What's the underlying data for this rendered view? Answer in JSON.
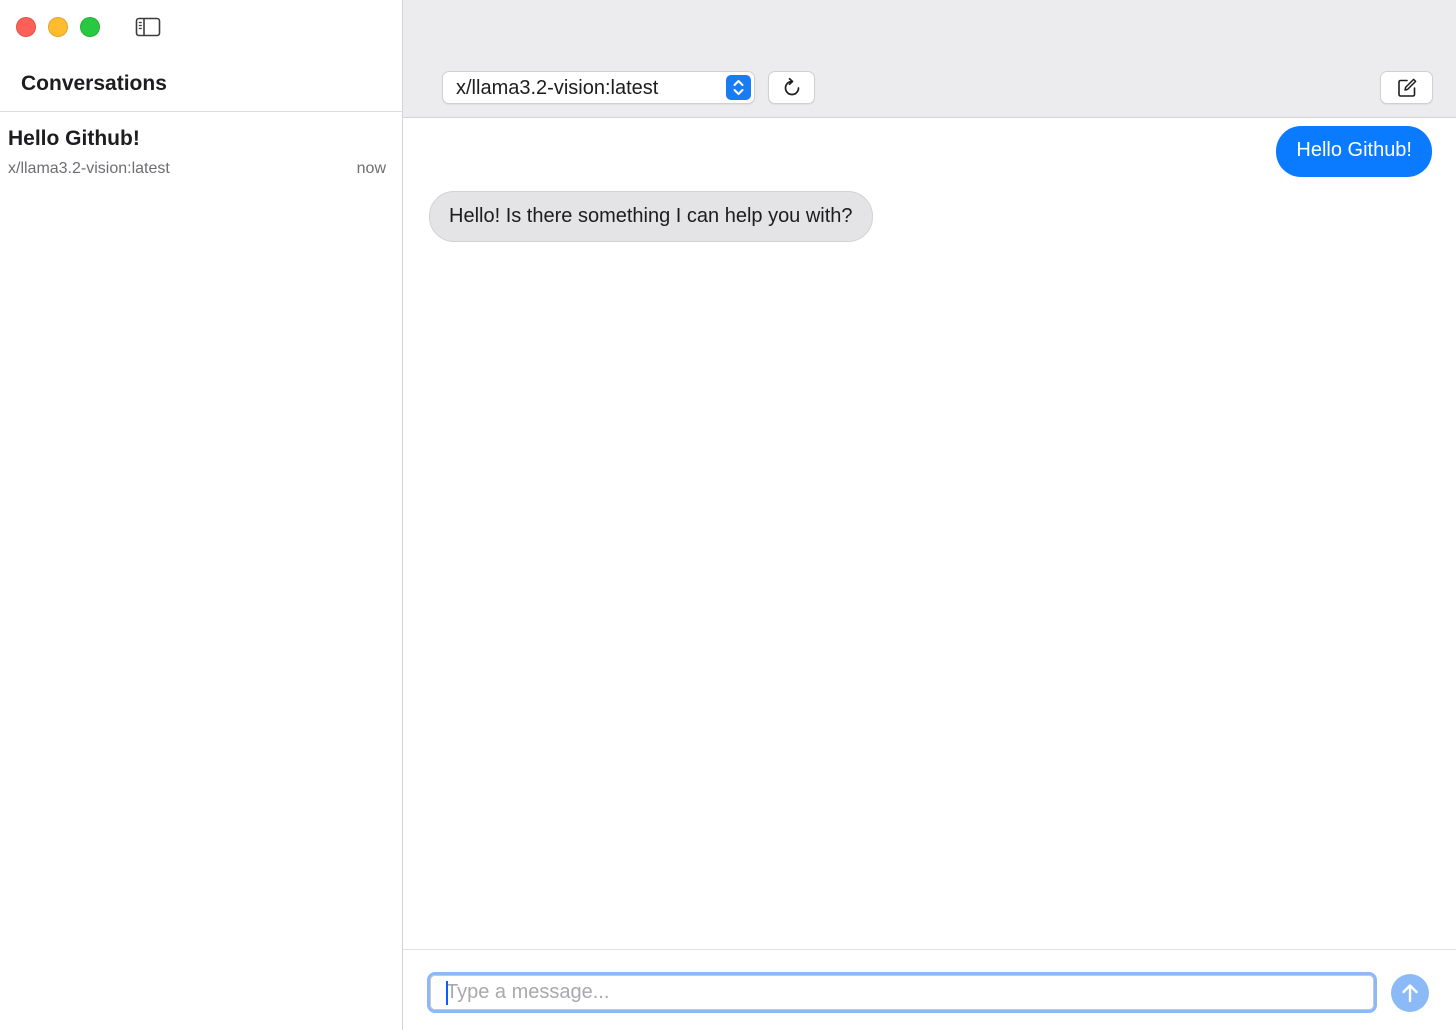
{
  "sidebar": {
    "title": "Conversations",
    "conversations": [
      {
        "title": "Hello Github!",
        "model": "x/llama3.2-vision:latest",
        "time": "now"
      }
    ]
  },
  "toolbar": {
    "model_selected": "x/llama3.2-vision:latest"
  },
  "messages": [
    {
      "role": "user",
      "text": "Hello Github!"
    },
    {
      "role": "assistant",
      "text": "Hello! Is there something I can help you with?"
    }
  ],
  "composer": {
    "placeholder": "Type a message...",
    "value": ""
  },
  "colors": {
    "accent": "#0a7aff",
    "send_disabled": "#8cbaf7",
    "assistant_bubble": "#e4e4e6",
    "close": "#fe5f57",
    "minimize": "#febc2e",
    "zoom": "#28c840"
  },
  "icons": {
    "sidebar_toggle": "sidebar-toggle-icon",
    "select_stepper": "chevron-up-down-icon",
    "refresh": "refresh-icon",
    "compose": "compose-icon",
    "send": "arrow-up-icon"
  }
}
